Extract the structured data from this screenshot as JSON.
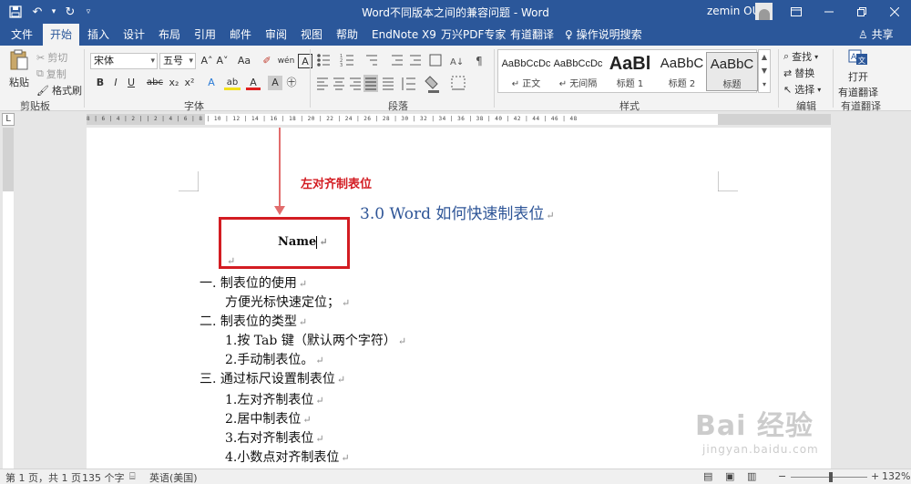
{
  "window": {
    "title": "Word不同版本之间的兼容问题 - Word",
    "user": "zemin OU"
  },
  "tabs": [
    "文件",
    "开始",
    "插入",
    "设计",
    "布局",
    "引用",
    "邮件",
    "审阅",
    "视图",
    "帮助",
    "EndNote X9",
    "万兴PDF专家",
    "有道翻译",
    "操作说明搜索"
  ],
  "share_label": "共享",
  "clipboard": {
    "paste": "粘贴",
    "cut": "剪切",
    "copy": "复制",
    "format_painter": "格式刷",
    "group": "剪贴板"
  },
  "font": {
    "name": "宋体",
    "size": "五号",
    "group": "字体",
    "grow": "A˄",
    "shrink": "A˅",
    "case": "Aa",
    "clear": "✐",
    "wen": "wén",
    "border_char": "A",
    "bold": "B",
    "italic": "I",
    "underline": "U",
    "strike": "abc",
    "sub": "x₂",
    "sup": "x²",
    "effects": "A",
    "highlight": "ab",
    "color": "A",
    "shade": "A",
    "enclose": "㊉"
  },
  "paragraph": {
    "group": "段落"
  },
  "styles": {
    "group": "样式",
    "items": [
      {
        "preview": "AaBbCcDc",
        "name": "↵ 正文"
      },
      {
        "preview": "AaBbCcDc",
        "name": "↵ 无间隔"
      },
      {
        "preview": "AaBl",
        "name": "标题 1"
      },
      {
        "preview": "AaBbC",
        "name": "标题 2"
      },
      {
        "preview": "AaBbC",
        "name": "标题"
      }
    ]
  },
  "editing": {
    "group": "编辑",
    "find": "查找",
    "replace": "替换",
    "select": "选择"
  },
  "translate": {
    "open": "打开",
    "label": "有道翻译",
    "group": "有道翻译"
  },
  "ruler_text": "8 | 6 | 4 | 2 |   | 2 | 4 | 6 | 8 | 10 | 12 | 14 | 16 | 18 | 20 | 22 | 24 | 26 | 28 | 30 | 32 | 34 | 36 | 38 | 40 | 42 | 44 | 46 | 48",
  "ruler_tab": "L",
  "document": {
    "annotation": "左对齐制表位",
    "heading": "3.0 Word 如何快速制表位",
    "boxed_text": "Name",
    "lines": [
      "一. 制表位的使用",
      "方便光标快速定位；",
      "二. 制表位的类型",
      "1.按 Tab 键（默认两个字符）",
      "2.手动制表位。",
      "三. 通过标尺设置制表位",
      "1.左对齐制表位",
      "2.居中制表位",
      "3.右对齐制表位",
      "4.小数点对齐制表位"
    ],
    "para_mark": "↵"
  },
  "watermark": {
    "logo": "Bai 经验",
    "url": "jingyan.baidu.com"
  },
  "status": {
    "page": "第 1 页，共 1 页",
    "words": "135 个字",
    "lang": "英语(美国)",
    "zoom": "132%",
    "zoom_minus": "−",
    "zoom_plus": "+"
  },
  "colors": {
    "title_bar": "#2b579a",
    "heading": "#2e5597",
    "annotation": "#d31c22"
  }
}
